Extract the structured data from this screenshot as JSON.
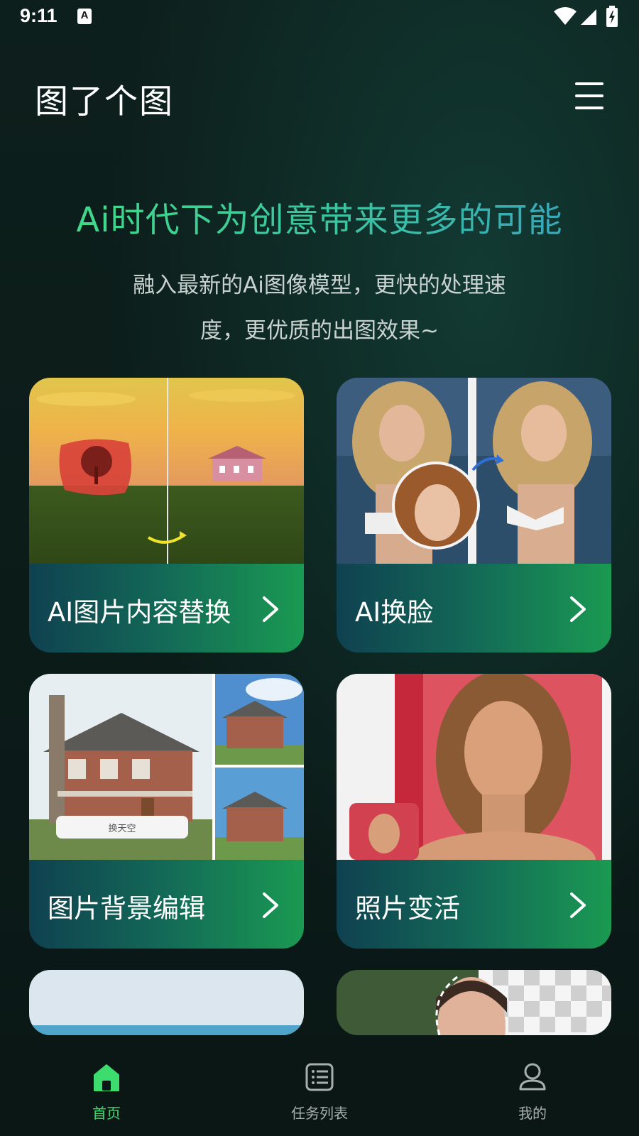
{
  "status_bar": {
    "time": "9:11",
    "notification_badge": "A"
  },
  "header": {
    "app_title": "图了个图",
    "menu_icon": "hamburger-menu-icon"
  },
  "hero": {
    "headline": "Ai时代下为创意带来更多的可能",
    "subline_1": "融入最新的Ai图像模型，更快的处理速",
    "subline_2": "度，更优质的出图效果~"
  },
  "cards": [
    {
      "label": "AI图片内容替换"
    },
    {
      "label": "AI换脸"
    },
    {
      "label": "图片背景编辑",
      "image_caption": "换天空"
    },
    {
      "label": "照片变活"
    }
  ],
  "tabbar": {
    "items": [
      {
        "label": "首页",
        "icon": "home-icon",
        "active": true
      },
      {
        "label": "任务列表",
        "icon": "task-list-icon",
        "active": false
      },
      {
        "label": "我的",
        "icon": "profile-icon",
        "active": false
      }
    ]
  },
  "colors": {
    "accent_green": "#3ddc6e",
    "headline_gradient_start": "#3fd98a",
    "headline_gradient_end": "#37a7b8",
    "card_bar_start": "#0f4150",
    "card_bar_end": "#1a9a52",
    "background": "#0b1c19"
  }
}
